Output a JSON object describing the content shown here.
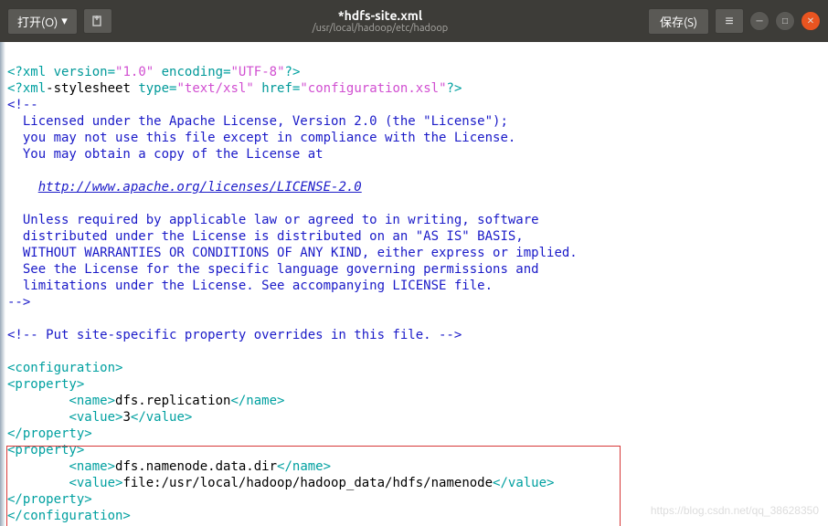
{
  "titlebar": {
    "open_label": "打开(O)",
    "title": "*hdfs-site.xml",
    "subtitle": "/usr/local/hadoop/etc/hadoop",
    "save_label": "保存(S)"
  },
  "code": {
    "xml_decl_open": "<?xml ",
    "version_attr": "version",
    "version_val": "\"1.0\"",
    "encoding_attr": "encoding",
    "encoding_val": "\"UTF-8\"",
    "decl_close": "?>",
    "xsl_open": "<?xml",
    "xsl_stylesheet": "-stylesheet ",
    "type_attr": "type",
    "type_val": "\"text/xsl\"",
    "href_attr": "href",
    "href_val": "\"configuration.xsl\"",
    "comment_open": "<!--",
    "license1": "  Licensed under the Apache License, Version 2.0 (the \"License\");",
    "license2": "  you may not use this file except in compliance with the License.",
    "license3": "  You may obtain a copy of the License at",
    "license_url": "http://www.apache.org/licenses/LICENSE-2.0",
    "license4": "  Unless required by applicable law or agreed to in writing, software",
    "license5": "  distributed under the License is distributed on an \"AS IS\" BASIS,",
    "license6": "  WITHOUT WARRANTIES OR CONDITIONS OF ANY KIND, either express or implied.",
    "license7": "  See the License for the specific language governing permissions and",
    "license8": "  limitations under the License. See accompanying LICENSE file.",
    "comment_close": "-->",
    "comment2": "<!-- Put site-specific property overrides in this file. -->",
    "tag_configuration_open": "<configuration>",
    "tag_property_open": "<property>",
    "indent": "        ",
    "tag_name_open": "<name>",
    "prop1_name": "dfs.replication",
    "tag_name_close": "</name>",
    "tag_value_open": "<value>",
    "prop1_value": "3",
    "tag_value_close": "</value>",
    "tag_property_close": "</property>",
    "prop2_name": "dfs.namenode.data.dir",
    "prop2_value": "file:/usr/local/hadoop/hadoop_data/hdfs/namenode",
    "tag_configuration_close": "</configuration>"
  },
  "watermark": "https://blog.csdn.net/qq_38628350"
}
